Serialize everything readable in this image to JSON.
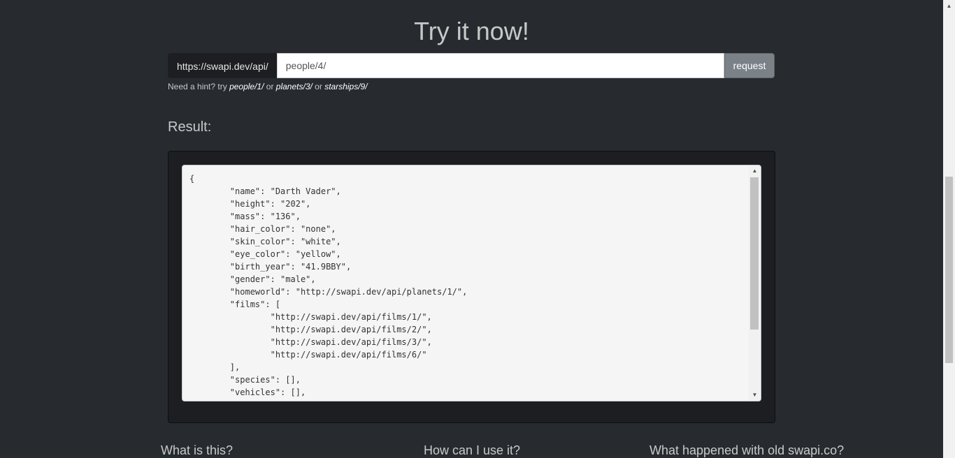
{
  "header": {
    "title": "Try it now!"
  },
  "request_bar": {
    "base_url": "https://swapi.dev/api/",
    "path_value": "people/4/",
    "request_label": "request"
  },
  "hint": {
    "prefix": "Need a hint? try ",
    "example1": "people/1/",
    "or1": " or ",
    "example2": "planets/3/",
    "or2": " or ",
    "example3": "starships/9/"
  },
  "result": {
    "label": "Result:",
    "json_text": "{\n\t\"name\": \"Darth Vader\",\n\t\"height\": \"202\",\n\t\"mass\": \"136\",\n\t\"hair_color\": \"none\",\n\t\"skin_color\": \"white\",\n\t\"eye_color\": \"yellow\",\n\t\"birth_year\": \"41.9BBY\",\n\t\"gender\": \"male\",\n\t\"homeworld\": \"http://swapi.dev/api/planets/1/\",\n\t\"films\": [\n\t\t\"http://swapi.dev/api/films/1/\",\n\t\t\"http://swapi.dev/api/films/2/\",\n\t\t\"http://swapi.dev/api/films/3/\",\n\t\t\"http://swapi.dev/api/films/6/\"\n\t],\n\t\"species\": [],\n\t\"vehicles\": [],"
  },
  "footer": {
    "headings": [
      "What is this?",
      "How can I use it?",
      "What happened with old swapi.co?"
    ]
  },
  "icons": {
    "scroll_up": "scroll-up-arrow-icon",
    "scroll_down": "scroll-down-arrow-icon"
  },
  "colors": {
    "background": "#272b30",
    "addon_background": "#1c1e22",
    "button_background": "#7a8288",
    "result_box_background": "#f5f5f5"
  }
}
